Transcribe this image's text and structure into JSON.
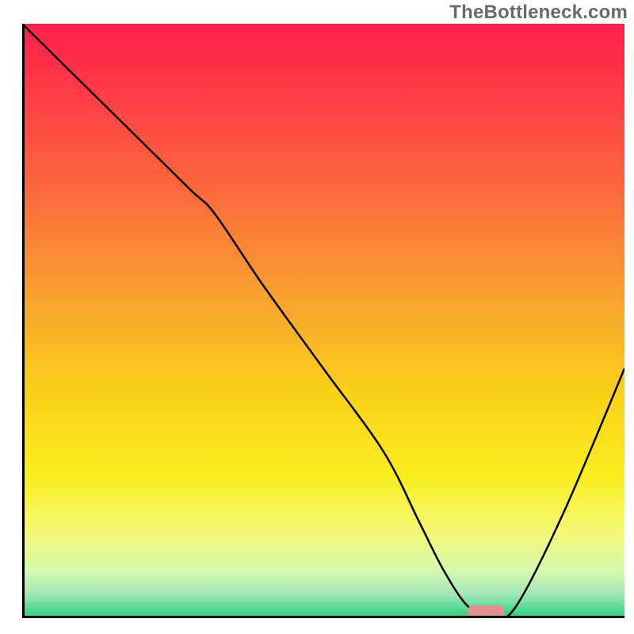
{
  "watermark": "TheBottleneck.com",
  "chart_data": {
    "type": "line",
    "title": "",
    "xlabel": "",
    "ylabel": "",
    "xlim": [
      0,
      100
    ],
    "ylim": [
      0,
      100
    ],
    "grid": false,
    "legend": false,
    "background_gradient_stops": [
      {
        "offset": 0.0,
        "color": "#ff1f4b"
      },
      {
        "offset": 0.14,
        "color": "#ff4245"
      },
      {
        "offset": 0.3,
        "color": "#fb6f3b"
      },
      {
        "offset": 0.48,
        "color": "#f9a82d"
      },
      {
        "offset": 0.62,
        "color": "#fad11a"
      },
      {
        "offset": 0.76,
        "color": "#faee1e"
      },
      {
        "offset": 0.86,
        "color": "#f3fa7a"
      },
      {
        "offset": 0.92,
        "color": "#d7f9af"
      },
      {
        "offset": 0.96,
        "color": "#a2e7b7"
      },
      {
        "offset": 1.0,
        "color": "#21cf78"
      }
    ],
    "series": [
      {
        "name": "bottleneck-curve",
        "color": "#000000",
        "x": [
          0,
          10,
          20,
          28,
          32,
          40,
          50,
          60,
          66,
          70,
          74,
          78,
          82,
          90,
          100
        ],
        "y": [
          100,
          90,
          80,
          72,
          68,
          56,
          42,
          28,
          16,
          8,
          2,
          0,
          2,
          18,
          42
        ]
      }
    ],
    "marker": {
      "name": "optimal-range",
      "color": "#e59090",
      "x_start": 74,
      "x_end": 80,
      "y": 0,
      "thickness": 1.6
    }
  }
}
